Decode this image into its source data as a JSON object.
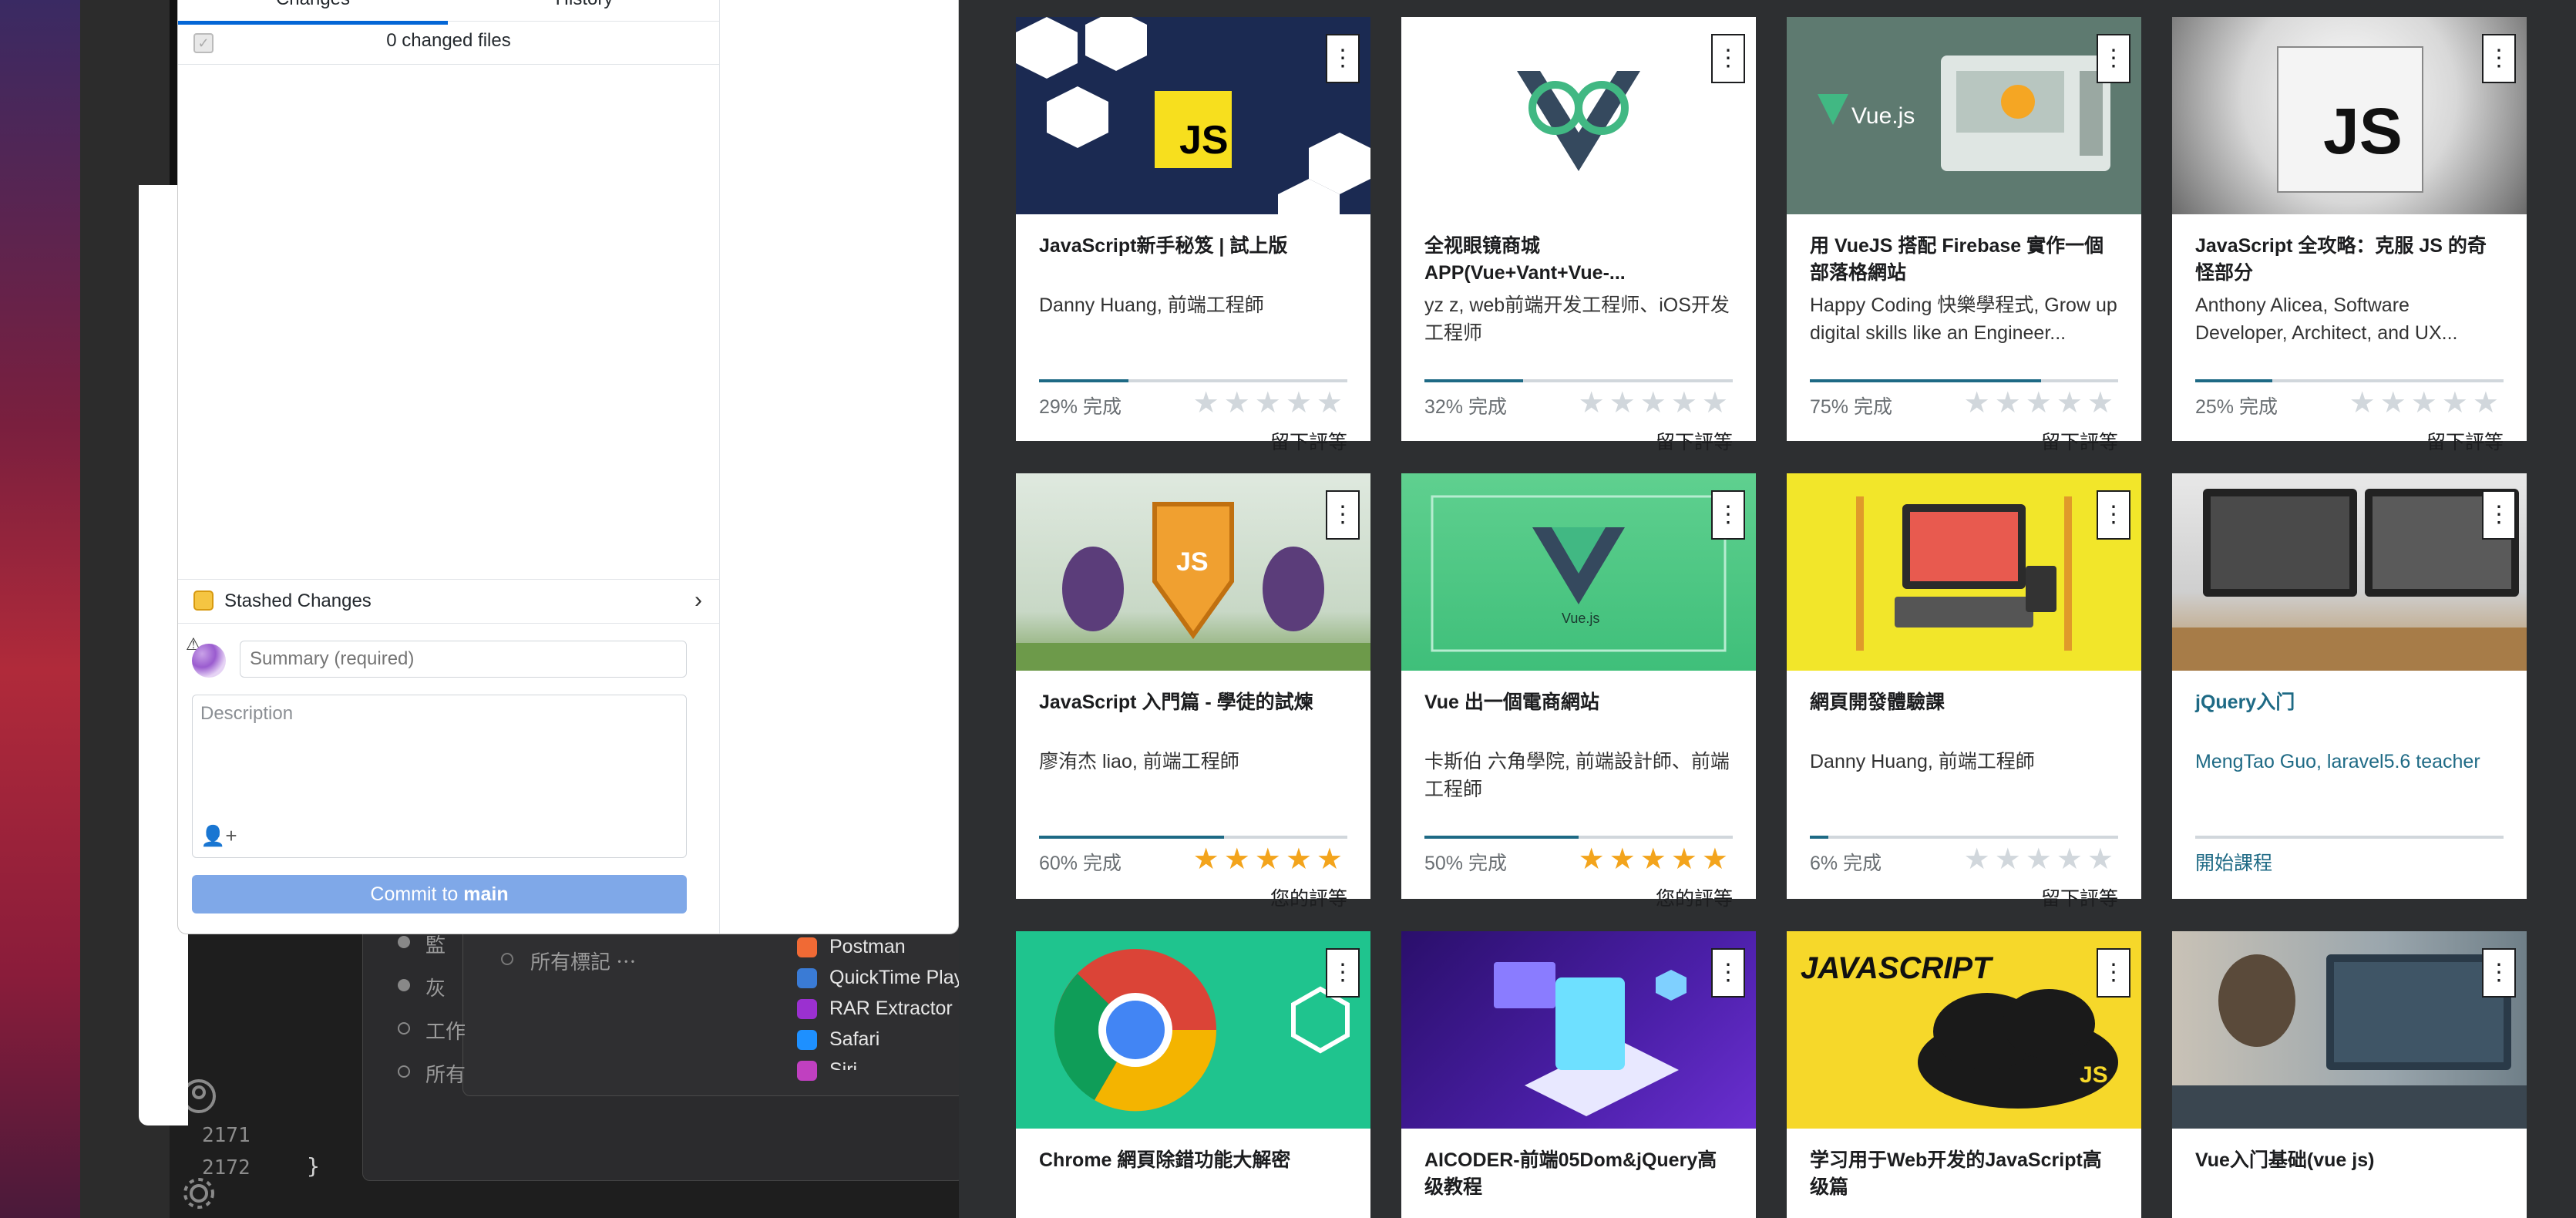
{
  "editor": {
    "line_numbers": [
      "2171",
      "2172"
    ],
    "brace": "}"
  },
  "finder": {
    "tags": [
      "監",
      "灰",
      "工作",
      "所有"
    ],
    "all_tags_label": "所有標記 ⋯",
    "apps": [
      "Postman",
      "QuickTime Play",
      "RAR Extractor",
      "Safari",
      "Siri"
    ]
  },
  "github": {
    "tabs": [
      "Changes",
      "History"
    ],
    "changed_files": "0 changed files",
    "stashed_label": "Stashed Changes",
    "summary_placeholder": "Summary (required)",
    "description_placeholder": "Description",
    "commit_prefix": "Commit to ",
    "commit_branch": "main"
  },
  "courses": [
    {
      "title": "JavaScript新手秘笈 | 試上版",
      "instructor": "Danny Huang, 前端工程師",
      "progress": 29,
      "progress_label": "29% 完成",
      "rating": 0,
      "rating_label": "留下評等",
      "thumb": "js-hex"
    },
    {
      "title": "全视眼镜商城APP(Vue+Vant+Vue-...",
      "instructor": "yz z, web前端开发工程师、iOS开发工程师",
      "progress": 32,
      "progress_label": "32% 完成",
      "rating": 0,
      "rating_label": "留下評等",
      "thumb": "vue-glasses"
    },
    {
      "title": "用 VueJS 搭配 Firebase 實作一個部落格網站",
      "instructor": "Happy Coding 快樂學程式, Grow up digital skills like an Engineer...",
      "progress": 75,
      "progress_label": "75% 完成",
      "rating": 0,
      "rating_label": "留下評等",
      "thumb": "vue-firebase"
    },
    {
      "title": "JavaScript 全攻略：克服 JS 的奇怪部分",
      "instructor": "Anthony Alicea, Software Developer, Architect, and UX...",
      "progress": 25,
      "progress_label": "25% 完成",
      "rating": 0,
      "rating_label": "留下評等",
      "thumb": "js-sketch"
    },
    {
      "title": "JavaScript 入門篇 - 學徒的試煉",
      "instructor": "廖洧杰 liao, 前端工程師",
      "progress": 60,
      "progress_label": "60% 完成",
      "rating": 5,
      "rating_label": "您的評等",
      "thumb": "js-shield"
    },
    {
      "title": "Vue 出一個電商網站",
      "instructor": "卡斯伯 六角學院, 前端設計師、前端工程師",
      "progress": 50,
      "progress_label": "50% 完成",
      "rating": 5,
      "rating_label": "您的評等",
      "thumb": "vue-green"
    },
    {
      "title": "網頁開發體驗課",
      "instructor": "Danny Huang, 前端工程師",
      "progress": 6,
      "progress_label": "6% 完成",
      "rating": 0,
      "rating_label": "留下評等",
      "thumb": "web-dev"
    },
    {
      "title": "jQuery入门",
      "instructor": "MengTao Guo, laravel5.6 teacher",
      "progress": 0,
      "progress_label": "開始課程",
      "rating": -1,
      "rating_label": "",
      "thumb": "desk"
    },
    {
      "title": "Chrome 網頁除錯功能大解密",
      "instructor": "",
      "progress": 0,
      "progress_label": "",
      "rating": -1,
      "rating_label": "",
      "thumb": "chrome"
    },
    {
      "title": "AICODER-前端05Dom&jQuery高级教程",
      "instructor": "",
      "progress": 0,
      "progress_label": "",
      "rating": -1,
      "rating_label": "",
      "thumb": "aicoder"
    },
    {
      "title": "学习用于Web开发的JavaScript高级篇",
      "instructor": "",
      "progress": 0,
      "progress_label": "",
      "rating": -1,
      "rating_label": "",
      "thumb": "js-cloud"
    },
    {
      "title": "Vue入门基础(vue js)",
      "instructor": "",
      "progress": 0,
      "progress_label": "",
      "rating": -1,
      "rating_label": "",
      "thumb": "coding-desk"
    }
  ],
  "thumb_text": {
    "js": "JS",
    "vuejs": "Vue.js",
    "javascript": "JAVASCRIPT"
  },
  "colors": {
    "accent_blue": "#0366d6",
    "commit_button": "#7fa8e8",
    "udemy_link": "#1e6a85",
    "star": "#f3a41c"
  }
}
